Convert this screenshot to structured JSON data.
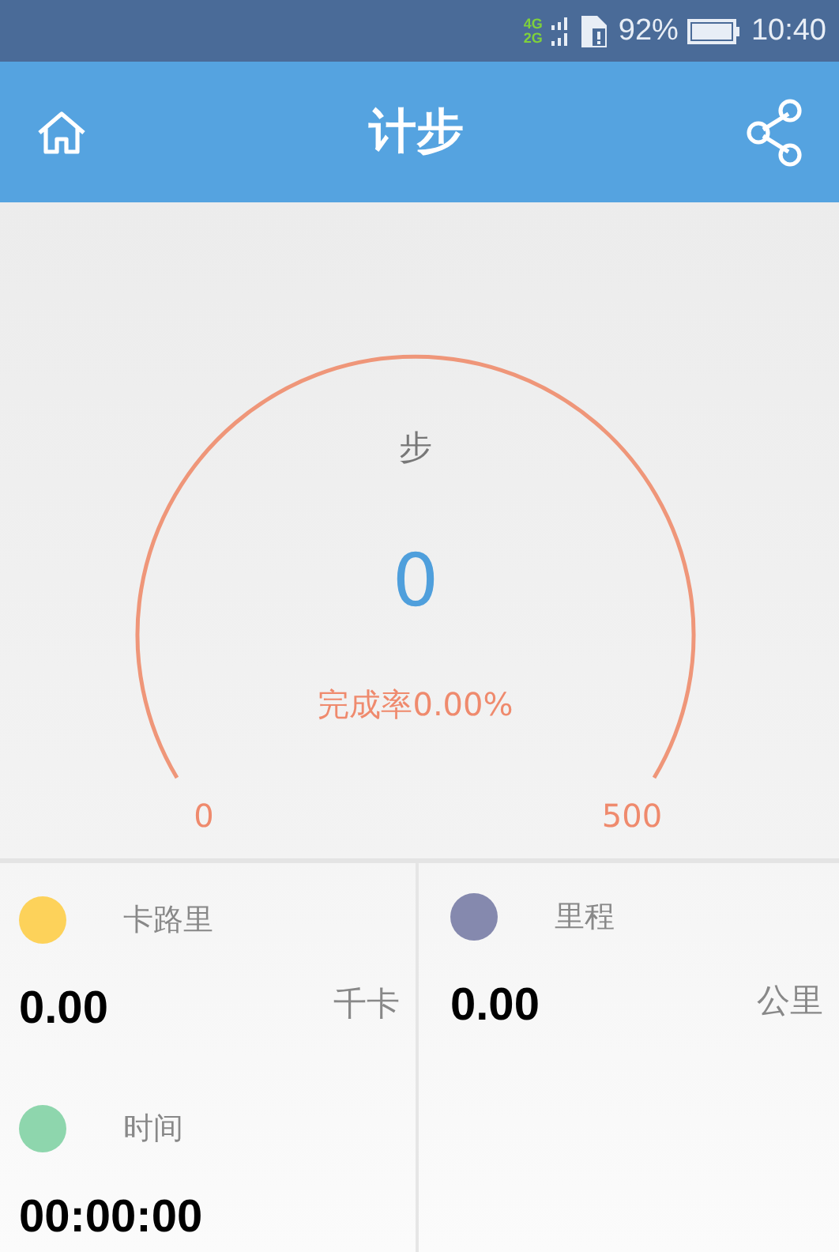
{
  "status_bar": {
    "network_labels": [
      "4G",
      "2G"
    ],
    "battery": "92%",
    "time": "10:40"
  },
  "header": {
    "title": "计步"
  },
  "gauge": {
    "unit": "步",
    "steps": "0",
    "completion": "完成率0.00%",
    "min": "0",
    "max": "500"
  },
  "stats": [
    [
      {
        "label": "卡路里",
        "value": "0.00",
        "unit": "千卡",
        "color": "#fdd25a"
      },
      {
        "label": "时间",
        "value": "00:00:00",
        "color": "#8ed6ad"
      }
    ],
    [
      {
        "label": "里程",
        "value": "0.00",
        "unit": "公里",
        "color": "#8589ae"
      }
    ]
  ]
}
